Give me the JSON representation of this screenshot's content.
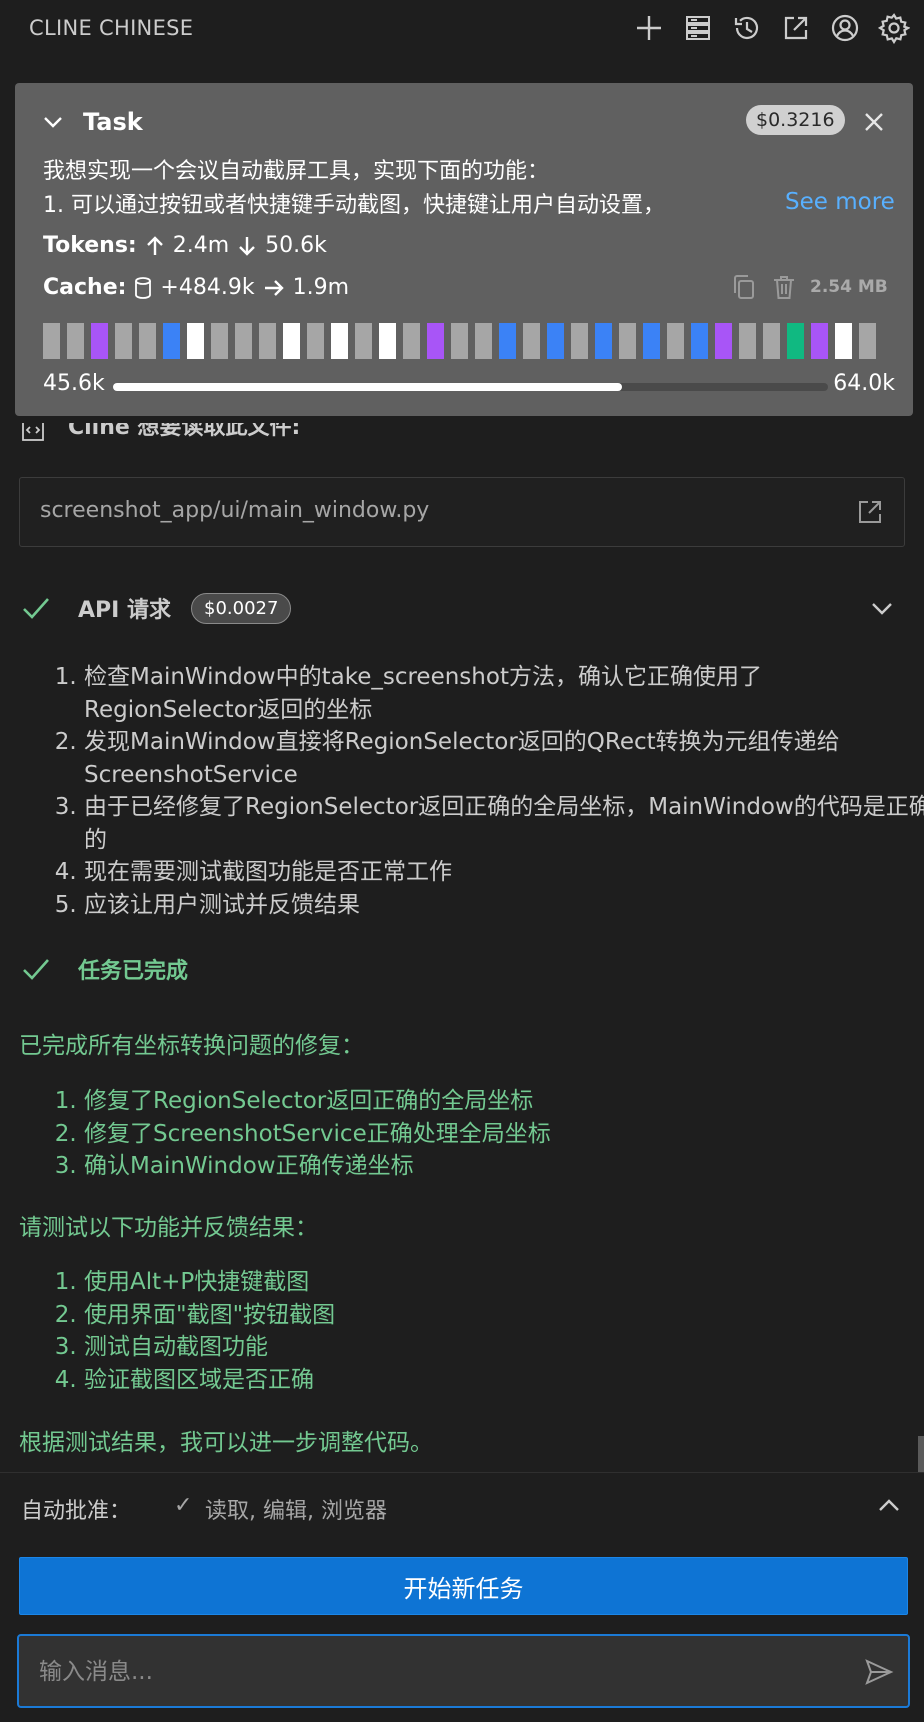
{
  "app": {
    "title": "CLINE CHINESE"
  },
  "topbar": {
    "icons": [
      "plus-icon",
      "server-icon",
      "history-icon",
      "external-link-icon",
      "account-icon",
      "settings-icon"
    ]
  },
  "task": {
    "title": "Task",
    "cost": "$0.3216",
    "text_line1": "我想实现一个会议自动截屏工具，实现下面的功能：",
    "text_line2": "1. 可以通过按钮或者快捷键手动截图，快捷键让用户自动设置，",
    "see_more": "See more",
    "tokens_label": "Tokens:",
    "tokens_in": "2.4m",
    "tokens_out": "50.6k",
    "cache_label": "Cache:",
    "cache_write": "+484.9k",
    "cache_read": "1.9m",
    "size": "2.54 MB",
    "context_used": "45.6k",
    "context_total": "64.0k",
    "context_fraction": 0.712
  },
  "colors": {
    "gray": "#a6a6a6",
    "purple": "#a855f7",
    "blue": "#3b82f6",
    "white": "#ffffff",
    "green": "#10b981",
    "success_text": "#73c991",
    "accent": "#0e74d4"
  },
  "segments": [
    "gray",
    "gray",
    "purple",
    "gray",
    "gray",
    "blue",
    "white",
    "gray",
    "gray",
    "gray",
    "white",
    "gray",
    "white",
    "gray",
    "white",
    "gray",
    "purple",
    "gray",
    "gray",
    "blue",
    "gray",
    "blue",
    "gray",
    "blue",
    "gray",
    "blue",
    "gray",
    "blue",
    "purple",
    "gray",
    "gray",
    "green",
    "purple",
    "white",
    "gray"
  ],
  "file_read": {
    "header": "Cline 想要读取此文件:",
    "path": "screenshot_app/ui/main_window.py"
  },
  "api": {
    "title": "API 请求",
    "cost": "$0.0027",
    "steps": [
      "检查MainWindow中的take_screenshot方法，确认它正确使用了RegionSelector返回的坐标",
      "发现MainWindow直接将RegionSelector返回的QRect转换为元组传递给ScreenshotService",
      "由于已经修复了RegionSelector返回正确的全局坐标，MainWindow的代码是正确的",
      "现在需要测试截图功能是否正常工作",
      "应该让用户测试并反馈结果"
    ]
  },
  "completion": {
    "title": "任务已完成",
    "intro": "已完成所有坐标转换问题的修复：",
    "fixes": [
      "修复了RegionSelector返回正确的全局坐标",
      "修复了ScreenshotService正确处理全局坐标",
      "确认MainWindow正确传递坐标"
    ],
    "test_intro": "请测试以下功能并反馈结果：",
    "tests": [
      "使用Alt+P快捷键截图",
      "使用界面\"截图\"按钮截图",
      "测试自动截图功能",
      "验证截图区域是否正确"
    ],
    "conclusion": "根据测试结果，我可以进一步调整代码。"
  },
  "auto_approve": {
    "label": "自动批准：",
    "check": "✓",
    "values": "读取, 编辑, 浏览器"
  },
  "new_task_button": "开始新任务",
  "input": {
    "placeholder": "输入消息...",
    "value": ""
  }
}
